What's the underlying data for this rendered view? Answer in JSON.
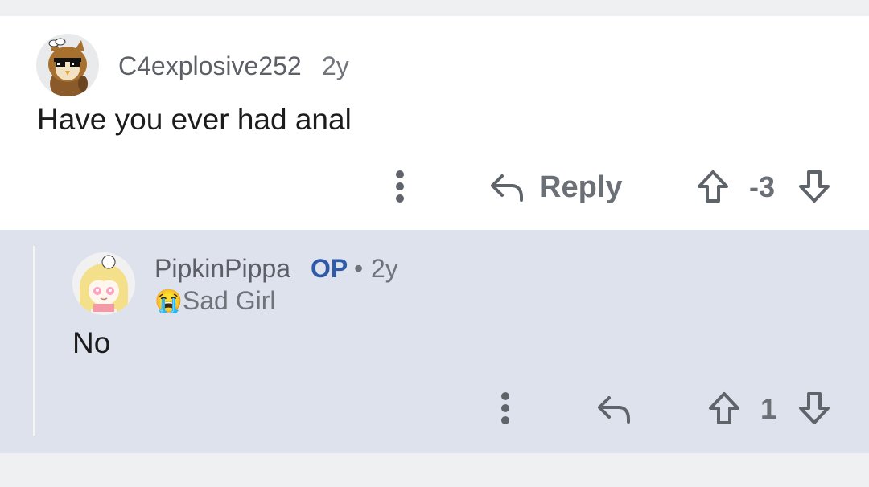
{
  "comment": {
    "author": "C4explosive252",
    "age": "2y",
    "body": "Have you ever had anal",
    "reply_label": "Reply",
    "score": "-3",
    "icons": {
      "avatar": "owl-avatar-with-pixel-sunglasses",
      "more": "more-vertical-icon",
      "reply": "reply-arrow-icon",
      "upvote": "upvote-arrow-icon",
      "downvote": "downvote-arrow-icon"
    }
  },
  "reply": {
    "author": "PipkinPippa",
    "op_badge": "OP",
    "separator": "•",
    "age": "2y",
    "flair_emoji": "😭",
    "flair_text": "Sad Girl",
    "body": "No",
    "score": "1",
    "icons": {
      "avatar": "blonde-girl-avatar",
      "more": "more-vertical-icon",
      "reply": "reply-arrow-icon",
      "upvote": "upvote-arrow-icon",
      "downvote": "downvote-arrow-icon"
    }
  },
  "colors": {
    "comment_background": "#ffffff",
    "reply_background": "#dde2ec",
    "page_background": "#eff0f2",
    "op_badge": "#2f5aa8",
    "text_muted": "#6b6f76",
    "text_body": "#1c1c1c"
  }
}
